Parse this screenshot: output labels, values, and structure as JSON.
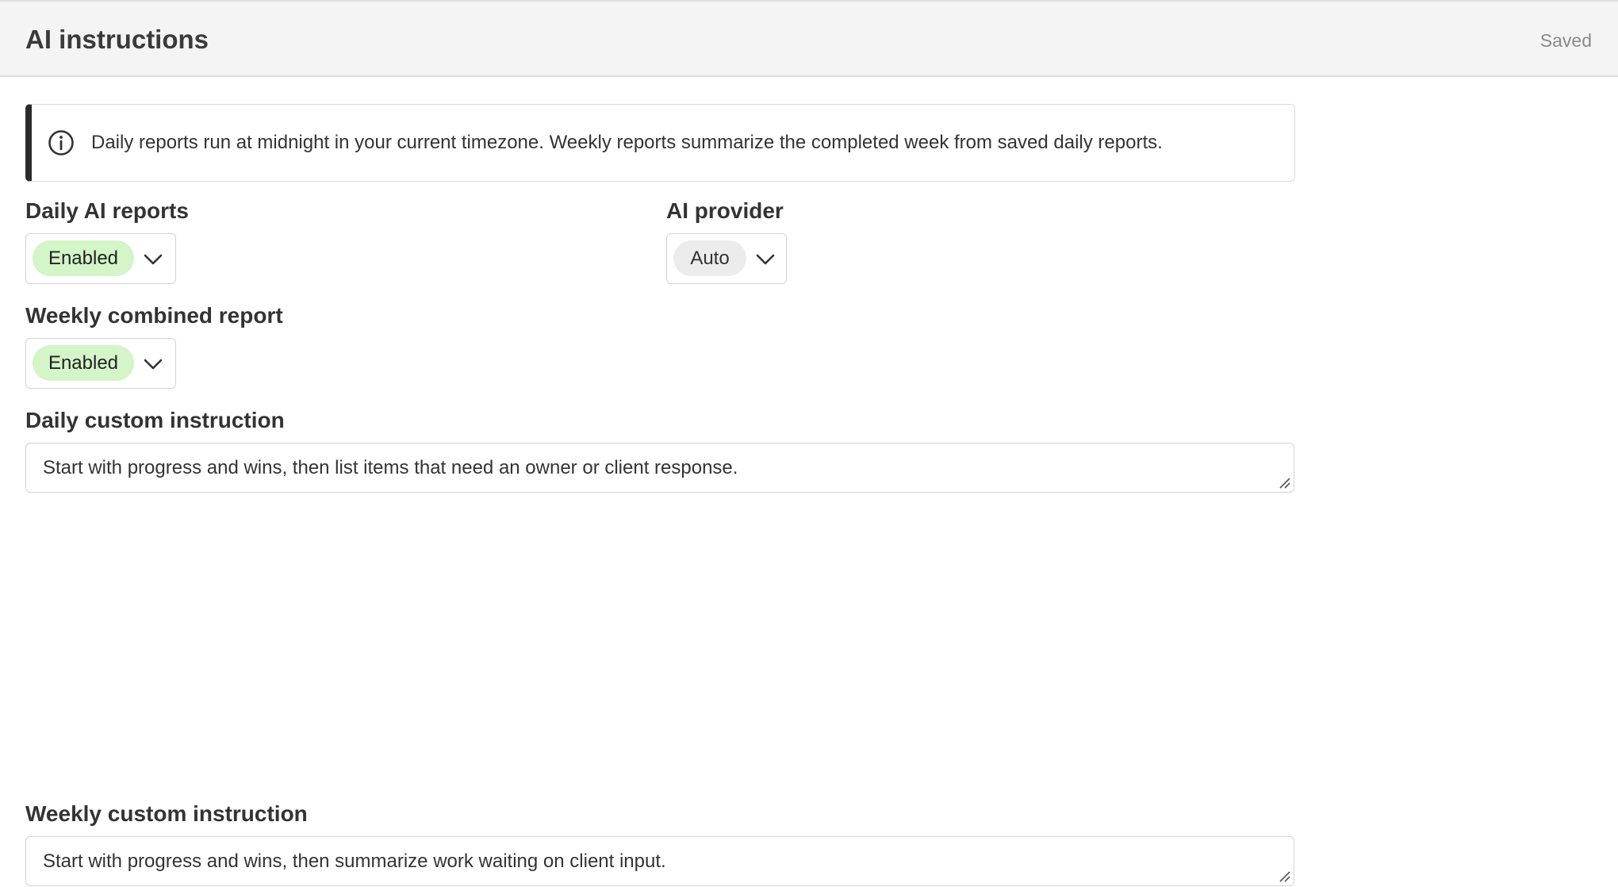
{
  "header": {
    "title": "AI instructions",
    "status": "Saved"
  },
  "info": {
    "icon": "info-circle-icon",
    "text": "Daily reports run at midnight in your current timezone. Weekly reports summarize the completed week from saved daily reports."
  },
  "daily_reports": {
    "label": "Daily AI reports",
    "value": "Enabled"
  },
  "ai_provider": {
    "label": "AI provider",
    "value": "Auto"
  },
  "weekly_report": {
    "label": "Weekly combined report",
    "value": "Enabled"
  },
  "daily_instruction": {
    "label": "Daily custom instruction",
    "value": "Start with progress and wins, then list items that need an owner or client response."
  },
  "weekly_instruction": {
    "label": "Weekly custom instruction",
    "value": "Start with progress and wins, then summarize work waiting on client input."
  },
  "colors": {
    "enabled_pill": "#d3f5c8",
    "neutral_pill": "#ececec",
    "banner_accent": "#2b2b2b",
    "header_bg": "#f4f4f4"
  }
}
